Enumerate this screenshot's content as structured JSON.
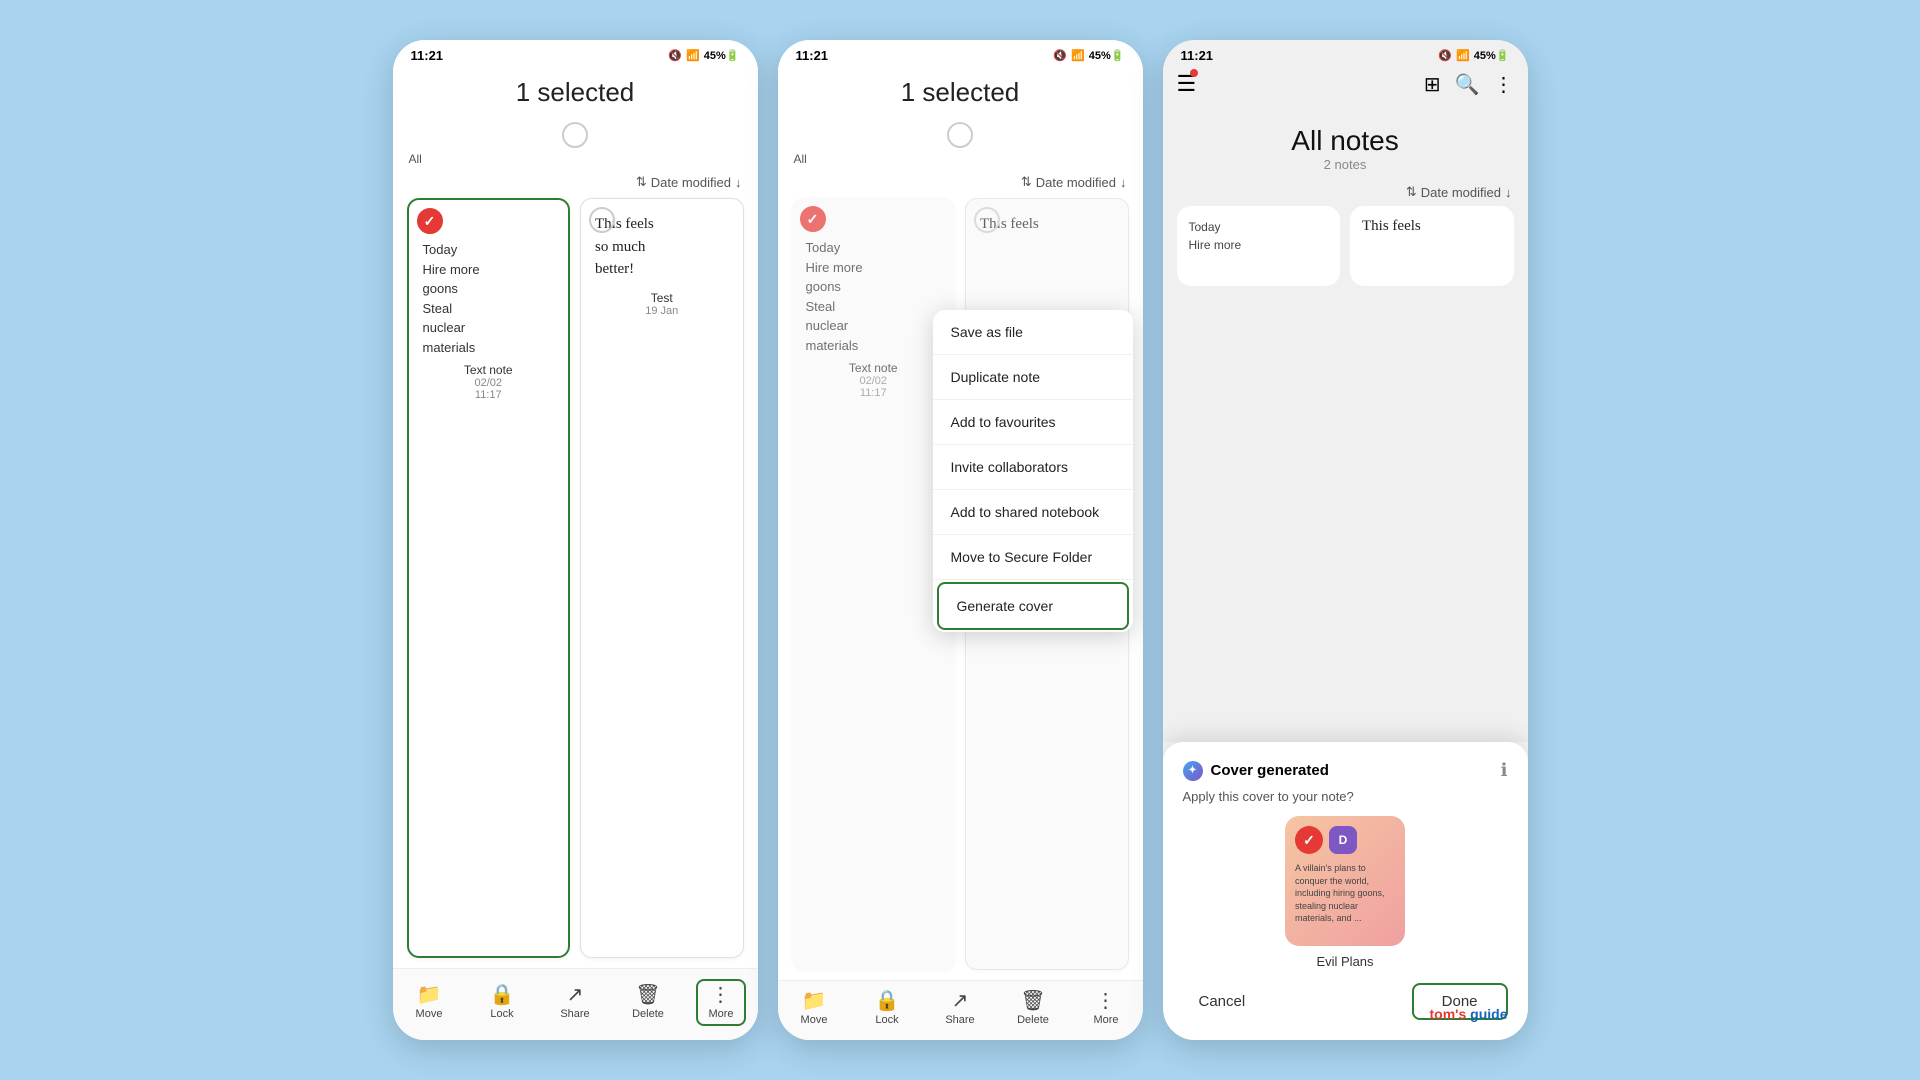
{
  "brand": {
    "name": "tom's guide",
    "highlight": "tom's"
  },
  "phone1": {
    "status_time": "11:21",
    "status_icons": "🔇📶45%🔋",
    "header_title": "1 selected",
    "all_label": "All",
    "sort_label": "Date modified",
    "note1": {
      "selected": true,
      "text": "Today\nHire more\ngoons\nSteal\nnuclear\nmaterials",
      "title": "Text note",
      "date": "02/02",
      "time": "11:17"
    },
    "note2": {
      "selected": false,
      "text_hw1": "This feels",
      "text_hw2": "so much",
      "text_hw3": "better!",
      "title": "Test",
      "date": "19 Jan"
    },
    "bottom_bar": {
      "move": "Move",
      "lock": "Lock",
      "share": "Share",
      "delete": "Delete",
      "more": "More"
    }
  },
  "phone2": {
    "status_time": "11:21",
    "header_title": "1 selected",
    "all_label": "All",
    "sort_label": "Date modified",
    "note1": {
      "text": "Today\nHire more\ngoons\nSteal\nnuclear\nmaterials",
      "title": "Text note",
      "date": "02/02",
      "time": "11:17"
    },
    "note2": {
      "text_hw1": "This feels"
    },
    "dropdown": {
      "items": [
        "Save as file",
        "Duplicate note",
        "Add to favourites",
        "Invite collaborators",
        "Add to shared notebook",
        "Move to Secure Folder",
        "Generate cover"
      ],
      "highlighted_index": 6
    },
    "bottom_bar": {
      "move": "Move",
      "lock": "Lock",
      "share": "Share",
      "delete": "Delete",
      "more": "More"
    }
  },
  "phone3": {
    "status_time": "11:21",
    "title": "All notes",
    "subtitle": "2 notes",
    "sort_label": "Date modified",
    "note1_preview": "Today\nHire more",
    "note2_preview": "This feels",
    "modal": {
      "title": "Cover generated",
      "body": "Apply this cover to your note?",
      "cover_label": "Evil Plans",
      "cover_text": "A villain's plans to conquer the world, including hiring goons, stealing nuclear materials, and ...",
      "cancel": "Cancel",
      "done": "Done"
    }
  }
}
